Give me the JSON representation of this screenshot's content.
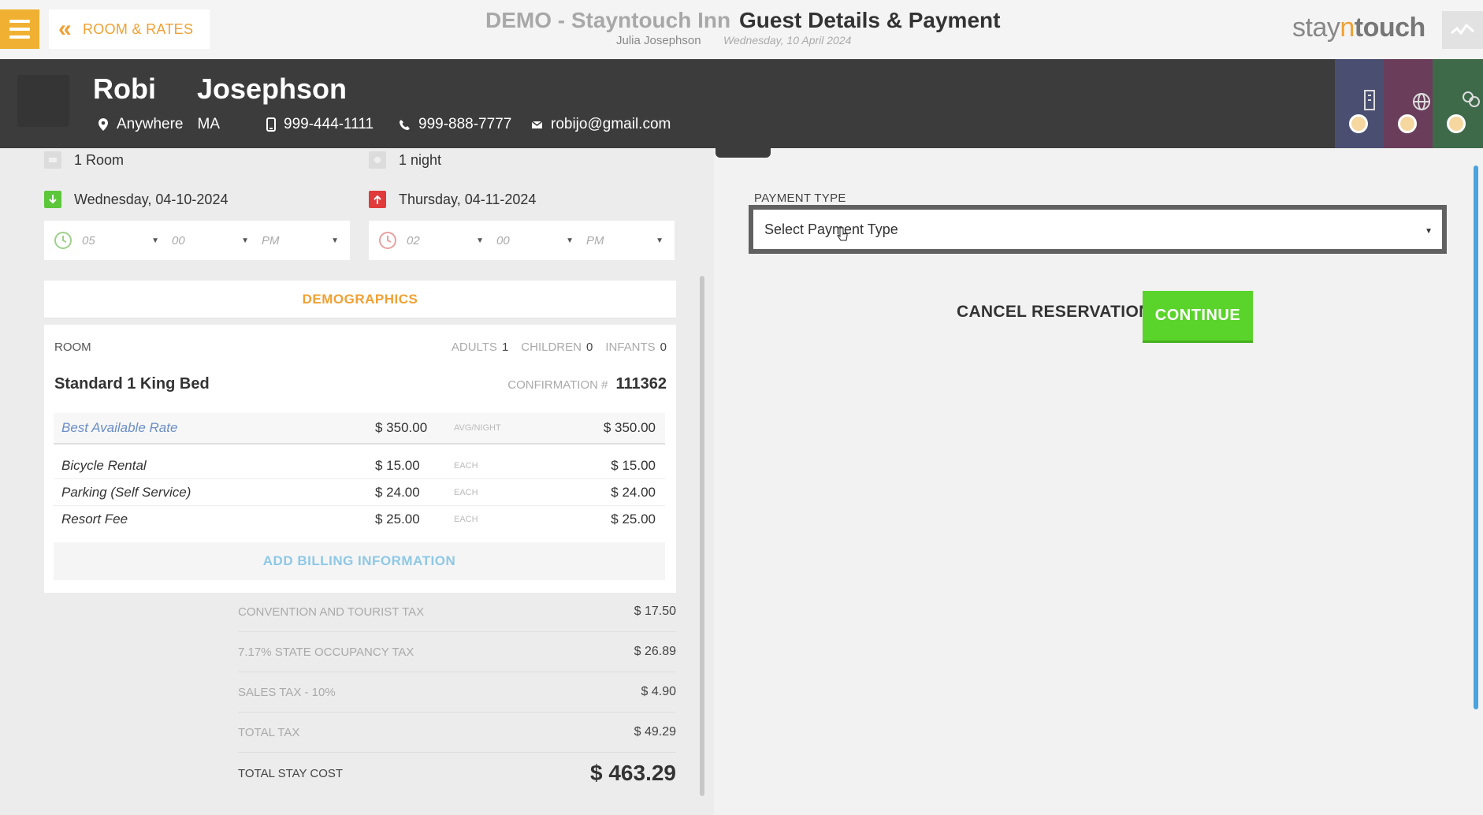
{
  "header": {
    "back_label": "ROOM & RATES",
    "hotel_name": "DEMO - Stayntouch Inn",
    "page_title": "Guest Details & Payment",
    "user_name": "Julia Josephson",
    "date": "Wednesday, 10 April 2024",
    "logo": {
      "part1": "stay",
      "part2": "n",
      "part3": "touch"
    }
  },
  "guest": {
    "first_name": "Robi",
    "last_name": "Josephson",
    "city": "Anywhere",
    "state": "MA",
    "mobile": "999-444-1111",
    "phone": "999-888-7777",
    "email": "robijo@gmail.com"
  },
  "side_tabs": [
    {
      "name": "hotel",
      "color": "#4a4f72"
    },
    {
      "name": "web",
      "color": "#6a3d5b"
    },
    {
      "name": "company",
      "color": "#3e6a4a"
    }
  ],
  "stay": {
    "rooms": "1 Room",
    "nights": "1 night",
    "arrival_date": "Wednesday, 04-10-2024",
    "departure_date": "Thursday, 04-11-2024",
    "arrival_time": {
      "hour": "05",
      "minute": "00",
      "ampm": "PM"
    },
    "departure_time": {
      "hour": "02",
      "minute": "00",
      "ampm": "PM"
    }
  },
  "demographics_label": "DEMOGRAPHICS",
  "room": {
    "section_label": "ROOM",
    "adults_label": "ADULTS",
    "adults": "1",
    "children_label": "CHILDREN",
    "children": "0",
    "infants_label": "INFANTS",
    "infants": "0",
    "room_type": "Standard 1 King Bed",
    "confirmation_label": "CONFIRMATION #",
    "confirmation": "111362",
    "rate": {
      "name": "Best Available Rate",
      "price": "$ 350.00",
      "unit": "AVG/NIGHT",
      "total": "$ 350.00"
    },
    "addons": [
      {
        "name": "Bicycle Rental",
        "price": "$ 15.00",
        "unit": "EACH",
        "total": "$ 15.00"
      },
      {
        "name": "Parking (Self Service)",
        "price": "$ 24.00",
        "unit": "EACH",
        "total": "$ 24.00"
      },
      {
        "name": "Resort Fee",
        "price": "$ 25.00",
        "unit": "EACH",
        "total": "$ 25.00"
      }
    ],
    "billing_label": "ADD BILLING INFORMATION"
  },
  "taxes": [
    {
      "label": "CONVENTION AND TOURIST TAX",
      "value": "$ 17.50"
    },
    {
      "label": "7.17% STATE OCCUPANCY TAX",
      "value": "$ 26.89"
    },
    {
      "label": "SALES TAX - 10%",
      "value": "$ 4.90"
    },
    {
      "label": "TOTAL TAX",
      "value": "$ 49.29"
    }
  ],
  "total": {
    "label": "TOTAL STAY COST",
    "value": "$ 463.29"
  },
  "payment": {
    "label": "PAYMENT TYPE",
    "selected": "Select Payment Type"
  },
  "actions": {
    "cancel": "CANCEL RESERVATION",
    "continue": "CONTINUE"
  }
}
